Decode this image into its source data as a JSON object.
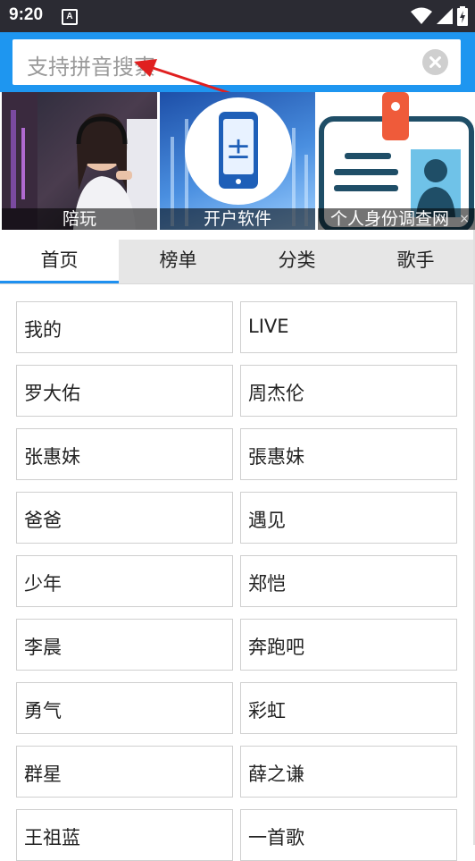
{
  "status_bar": {
    "time": "9:20",
    "notification_letter": "A",
    "icons": [
      "wifi-icon",
      "signal-icon",
      "battery-icon"
    ]
  },
  "search": {
    "placeholder": "支持拼音搜索"
  },
  "banner": {
    "cards": [
      {
        "caption": "陪玩",
        "image": "gamer-girl-headset"
      },
      {
        "caption": "开户软件",
        "image": "phone-app-blue"
      },
      {
        "caption": "个人身份调查网",
        "image": "id-card"
      }
    ],
    "ad_close": "×"
  },
  "tabs": [
    {
      "label": "首页",
      "active": true
    },
    {
      "label": "榜单",
      "active": false
    },
    {
      "label": "分类",
      "active": false
    },
    {
      "label": "歌手",
      "active": false
    }
  ],
  "grid_items": [
    "我的",
    "LIVE",
    "罗大佑",
    "周杰伦",
    "张惠妹",
    "張惠妹",
    "爸爸",
    "遇见",
    "少年",
    "郑恺",
    "李晨",
    "奔跑吧",
    "勇气",
    "彩虹",
    "群星",
    "薛之谦",
    "王祖蓝",
    "一首歌"
  ],
  "colors": {
    "header_blue": "#1e96f0",
    "tab_indicator": "#1e90f0",
    "status_bar": "#2b2b33",
    "annotation_arrow": "#e02020"
  }
}
